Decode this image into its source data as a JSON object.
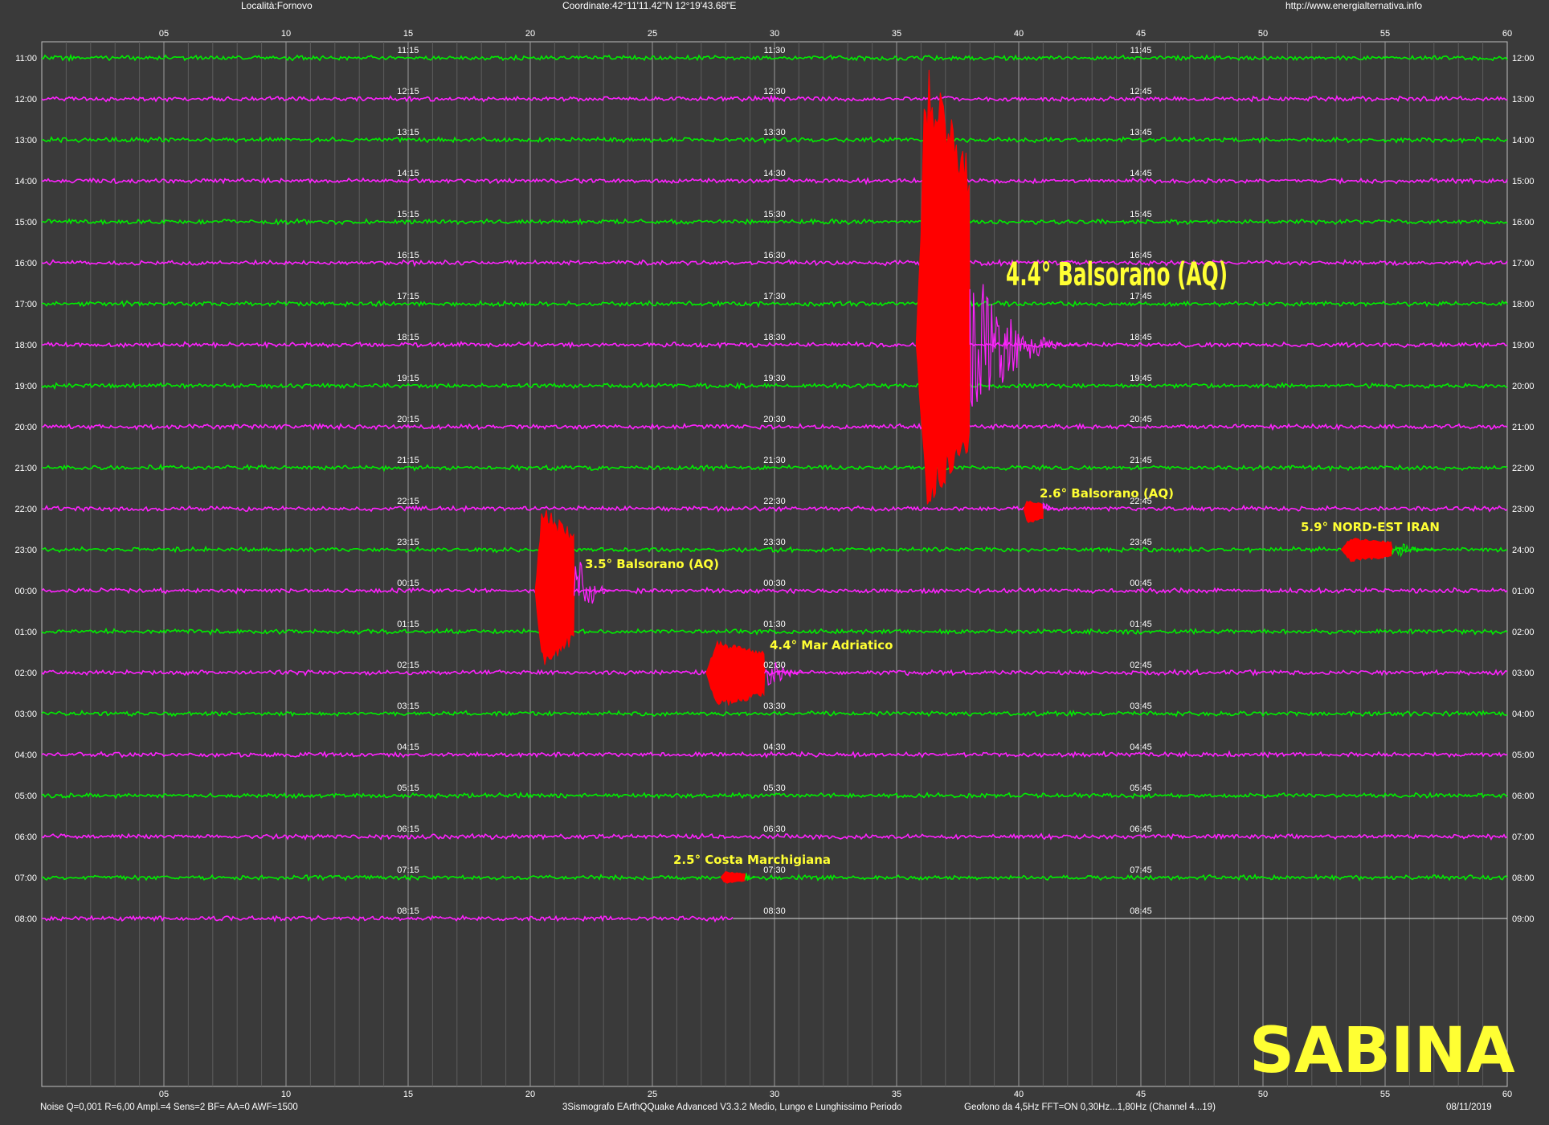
{
  "header": {
    "locality": "Località:Fornovo",
    "coordinates": "Coordinate:42°11'11.42\"N  12°19'43.68\"E",
    "website": "http://www.energialternativa.info"
  },
  "footer": {
    "noise": "Noise Q=0,001 R=6,00 Ampl.=4 Sens=2 BF= AA=0 AWF=1500",
    "software": "3Sismografo  EArthQQuake Advanced V3.3.2  Medio, Lungo e Lunghissimo Periodo",
    "sensor": "Geofono da 4,5Hz FFT=ON 0,30Hz...1,80Hz      (Channel 4...19)",
    "date": "08/11/2019"
  },
  "station_name": "SABINA",
  "colors": {
    "background": "#3a3a3a",
    "green_trace": "#00ee00",
    "magenta_trace": "#ff22ff",
    "event_red": "#ff0000",
    "annotation": "#ffff33",
    "grid": "#8a8a8a"
  },
  "chart_data": {
    "type": "seismogram",
    "x_axis": {
      "unit": "minutes",
      "range": [
        0,
        60
      ],
      "ticks": [
        "05",
        "10",
        "15",
        "20",
        "25",
        "30",
        "35",
        "40",
        "45",
        "50",
        "55",
        "60"
      ]
    },
    "rows": [
      {
        "left": "11:00",
        "right": "12:00",
        "mid": [
          "11:15",
          "11:30",
          "11:45"
        ],
        "color": "green"
      },
      {
        "left": "12:00",
        "right": "13:00",
        "mid": [
          "12:15",
          "12:30",
          "12:45"
        ],
        "color": "magenta"
      },
      {
        "left": "13:00",
        "right": "14:00",
        "mid": [
          "13:15",
          "13:30",
          "13:45"
        ],
        "color": "green"
      },
      {
        "left": "14:00",
        "right": "15:00",
        "mid": [
          "14:15",
          "14:30",
          "14:45"
        ],
        "color": "magenta"
      },
      {
        "left": "15:00",
        "right": "16:00",
        "mid": [
          "15:15",
          "15:30",
          "15:45"
        ],
        "color": "green"
      },
      {
        "left": "16:00",
        "right": "17:00",
        "mid": [
          "16:15",
          "16:30",
          "16:45"
        ],
        "color": "magenta"
      },
      {
        "left": "17:00",
        "right": "18:00",
        "mid": [
          "17:15",
          "17:30",
          "17:45"
        ],
        "color": "green"
      },
      {
        "left": "18:00",
        "right": "19:00",
        "mid": [
          "18:15",
          "18:30",
          "18:45"
        ],
        "color": "magenta"
      },
      {
        "left": "19:00",
        "right": "20:00",
        "mid": [
          "19:15",
          "19:30",
          "19:45"
        ],
        "color": "green"
      },
      {
        "left": "20:00",
        "right": "21:00",
        "mid": [
          "20:15",
          "20:30",
          "20:45"
        ],
        "color": "magenta"
      },
      {
        "left": "21:00",
        "right": "22:00",
        "mid": [
          "21:15",
          "21:30",
          "21:45"
        ],
        "color": "green"
      },
      {
        "left": "22:00",
        "right": "23:00",
        "mid": [
          "22:15",
          "22:30",
          "22:45"
        ],
        "color": "magenta"
      },
      {
        "left": "23:00",
        "right": "24:00",
        "mid": [
          "23:15",
          "23:30",
          "23:45"
        ],
        "color": "green"
      },
      {
        "left": "00:00",
        "right": "01:00",
        "mid": [
          "00:15",
          "00:30",
          "00:45"
        ],
        "color": "magenta"
      },
      {
        "left": "01:00",
        "right": "02:00",
        "mid": [
          "01:15",
          "01:30",
          "01:45"
        ],
        "color": "green"
      },
      {
        "left": "02:00",
        "right": "03:00",
        "mid": [
          "02:15",
          "02:30",
          "02:45"
        ],
        "color": "magenta"
      },
      {
        "left": "03:00",
        "right": "04:00",
        "mid": [
          "03:15",
          "03:30",
          "03:45"
        ],
        "color": "green"
      },
      {
        "left": "04:00",
        "right": "05:00",
        "mid": [
          "04:15",
          "04:30",
          "04:45"
        ],
        "color": "magenta"
      },
      {
        "left": "05:00",
        "right": "06:00",
        "mid": [
          "05:15",
          "05:30",
          "05:45"
        ],
        "color": "green"
      },
      {
        "left": "06:00",
        "right": "07:00",
        "mid": [
          "06:15",
          "06:30",
          "06:45"
        ],
        "color": "magenta"
      },
      {
        "left": "07:00",
        "right": "08:00",
        "mid": [
          "07:15",
          "07:30",
          "07:45"
        ],
        "color": "green"
      },
      {
        "left": "08:00",
        "right": "09:00",
        "mid": [
          "08:15",
          "08:30",
          "08:45"
        ],
        "color": "magenta",
        "end_minute": 28.3
      }
    ],
    "events": [
      {
        "label": "4.4° Balsorano (AQ)",
        "row": 7,
        "start_min": 35.8,
        "end_min": 38.0,
        "coda_end_min": 42.5,
        "up_rows": 7,
        "down_rows": 4
      },
      {
        "label": "3.5° Balsorano (AQ)",
        "row": 13,
        "start_min": 20.2,
        "end_min": 21.8,
        "coda_end_min": 23.5,
        "up_rows": 2.2,
        "down_rows": 2.0
      },
      {
        "label": "4.4° Mar Adriatico",
        "row": 15,
        "start_min": 27.2,
        "end_min": 29.6,
        "coda_end_min": 31.5,
        "up_rows": 0.8,
        "down_rows": 0.9
      },
      {
        "label": "2.6° Balsorano (AQ)",
        "row": 11,
        "start_min": 40.2,
        "end_min": 41.0,
        "coda_end_min": 41.6,
        "up_rows": 0.2,
        "down_rows": 0.4
      },
      {
        "label": "5.9° NORD-EST IRAN",
        "row": 12,
        "start_min": 53.2,
        "end_min": 55.3,
        "coda_end_min": 57.2,
        "up_rows": 0.3,
        "down_rows": 0.3
      },
      {
        "label": "2.5° Costa Marchigiana",
        "row": 20,
        "start_min": 27.8,
        "end_min": 28.8,
        "coda_end_min": 29.2,
        "up_rows": 0.15,
        "down_rows": 0.15
      }
    ]
  }
}
